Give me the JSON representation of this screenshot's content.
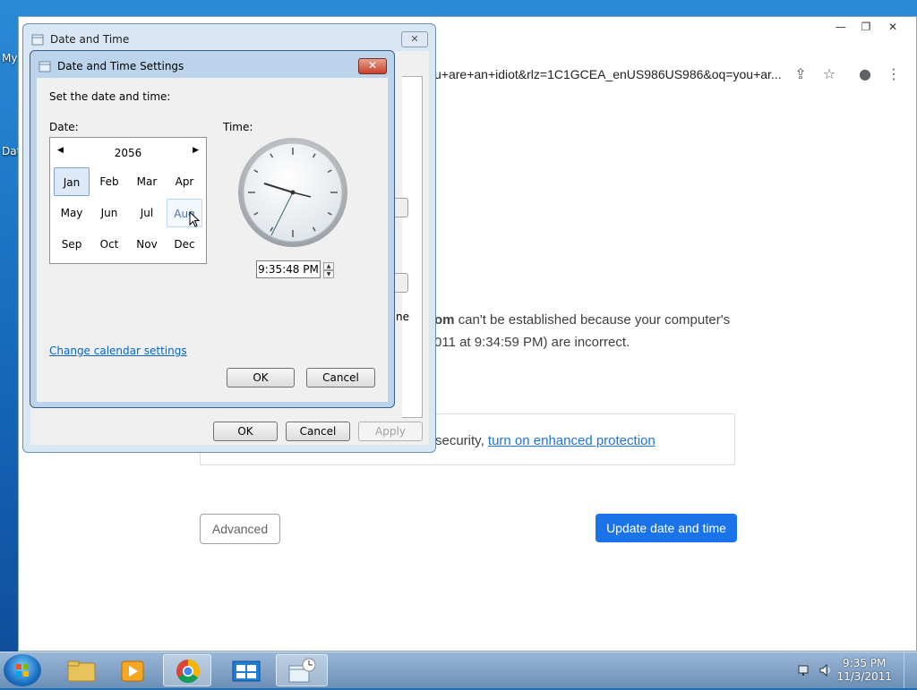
{
  "desktop": {
    "icons": [
      {
        "label": "My"
      },
      {
        "label": "Dat"
      }
    ]
  },
  "browser": {
    "address": "u+are+an+idiot&rlz=1C1GCEA_enUS986US986&oq=you+ar...",
    "error": {
      "line1_bold": "om",
      "line1_rest": " can't be established because your computer's",
      "line2": "011 at 9:34:59 PM) are incorrect.",
      "partial_label": "ne"
    },
    "protection": {
      "prefix": "security, ",
      "link": "turn on enhanced protection"
    },
    "advanced_label": "Advanced",
    "update_label": "Update date and time"
  },
  "date_time_dialog": {
    "title": "Date and Time",
    "ok_label": "OK",
    "cancel_label": "Cancel",
    "apply_label": "Apply"
  },
  "settings_dialog": {
    "title": "Date and Time Settings",
    "instruction": "Set the date and time:",
    "date_label": "Date:",
    "time_label": "Time:",
    "year": "2056",
    "months": [
      "Jan",
      "Feb",
      "Mar",
      "Apr",
      "May",
      "Jun",
      "Jul",
      "Aug",
      "Sep",
      "Oct",
      "Nov",
      "Dec"
    ],
    "time_value": "9:35:48 PM",
    "change_calendar_link": "Change calendar settings",
    "ok_label": "OK",
    "cancel_label": "Cancel"
  },
  "taskbar": {
    "time": "9:35 PM",
    "date": "11/3/2011"
  }
}
